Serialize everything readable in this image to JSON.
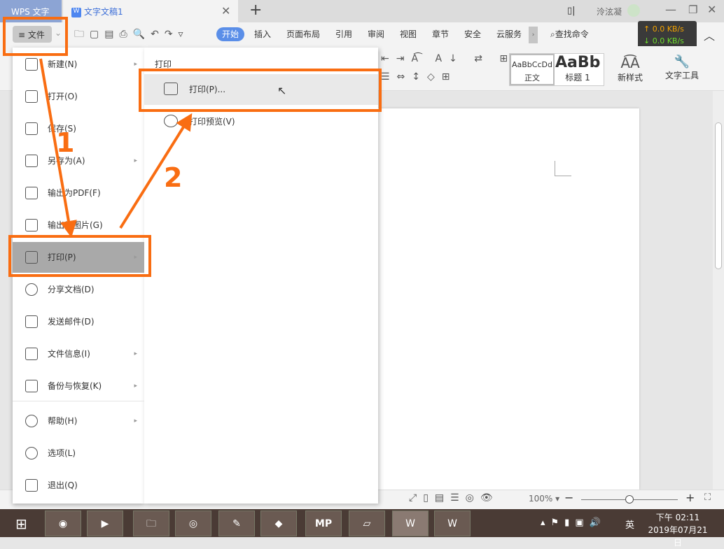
{
  "titlebar": {
    "app_tab": "WPS 文字",
    "doc_tab": "文字文稿1",
    "user": "泠泫凝",
    "new_tab": "+"
  },
  "toolbar": {
    "file_menu": "文件",
    "tabs": [
      "开始",
      "插入",
      "页面布局",
      "引用",
      "审阅",
      "视图",
      "章节",
      "安全",
      "云服务"
    ],
    "search": "查找命令",
    "net_up": "↑ 0.0 KB/s",
    "net_down": "↓ 0.0 KB/s"
  },
  "ribbon": {
    "style_normal_preview": "AaBbCcDd",
    "style_normal": "正文",
    "style_h1_preview": "AaBb",
    "style_h1": "标题 1",
    "new_style": "新样式",
    "text_tools": "文字工具"
  },
  "file_menu": {
    "items": [
      {
        "label": "新建(N)",
        "arrow": true
      },
      {
        "label": "打开(O)"
      },
      {
        "label": "保存(S)"
      },
      {
        "label": "另存为(A)",
        "arrow": true
      },
      {
        "label": "输出为PDF(F)"
      },
      {
        "label": "输出为图片(G)"
      },
      {
        "label": "打印(P)",
        "arrow": true,
        "selected": true
      },
      {
        "label": "分享文档(D)"
      },
      {
        "label": "发送邮件(D)"
      },
      {
        "label": "文件信息(I)",
        "arrow": true
      },
      {
        "label": "备份与恢复(K)",
        "arrow": true
      },
      {
        "label": "帮助(H)",
        "arrow": true
      },
      {
        "label": "选项(L)"
      },
      {
        "label": "退出(Q)"
      }
    ]
  },
  "print_submenu": {
    "title": "打印",
    "items": [
      "打印(P)...",
      "打印预览(V)"
    ]
  },
  "annotations": {
    "step1": "1",
    "step2": "2",
    "color": "#f96d12"
  },
  "status": {
    "zoom": "100%",
    "zoom_level": 0.5
  },
  "taskbar": {
    "ime": "英",
    "time": "下午 02:11",
    "date": "2019年07月21日"
  }
}
